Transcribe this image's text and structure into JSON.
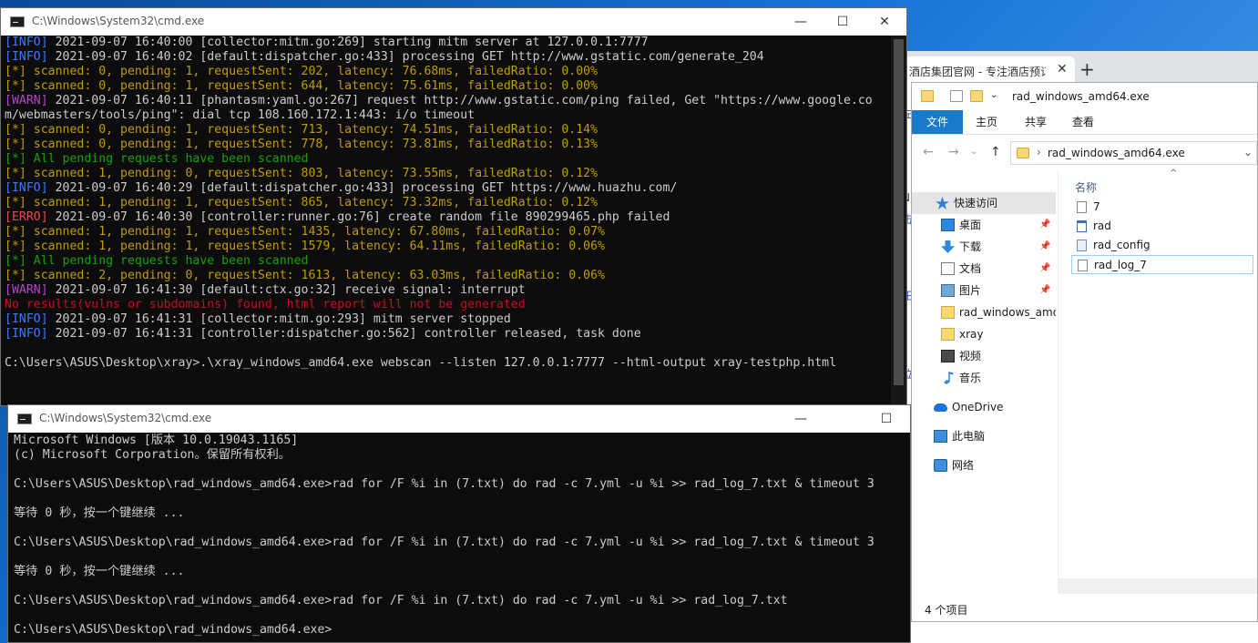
{
  "browser": {
    "tab_title": "酒店集团官网 - 专注酒店预订",
    "tab_close": "✕",
    "new_tab": "+",
    "side_marks": [
      "左",
      "N",
      "击",
      "正",
      "泣"
    ]
  },
  "cmd_top": {
    "title": "C:\\Windows\\System32\\cmd.exe",
    "controls": {
      "minimize": "—",
      "maximize": "☐",
      "close": "✕"
    },
    "lines": [
      {
        "segs": [
          {
            "t": "[INFO]",
            "c": "#3b78ff"
          },
          {
            "t": " 2021-09-07 16:40:00 [collector:mitm.go:269] starting mitm server at 127.0.0.1:7777",
            "c": "#cccccc"
          }
        ]
      },
      {
        "segs": [
          {
            "t": "[INFO]",
            "c": "#3b78ff"
          },
          {
            "t": " 2021-09-07 16:40:02 [default:dispatcher.go:433] processing GET http://www.gstatic.com/generate_204",
            "c": "#cccccc"
          }
        ]
      },
      {
        "segs": [
          {
            "t": "[*] scanned: 0, pending: 1, requestSent: 202, latency: 76.68ms, failedRatio: 0.00%",
            "c": "#c19c00"
          }
        ]
      },
      {
        "segs": [
          {
            "t": "[*] scanned: 0, pending: 1, requestSent: 644, latency: 75.61ms, failedRatio: 0.00%",
            "c": "#c19c00"
          }
        ]
      },
      {
        "segs": [
          {
            "t": "[WARN]",
            "c": "#b148c6"
          },
          {
            "t": " 2021-09-07 16:40:11 [phantasm:yaml.go:267] request http://www.gstatic.com/ping failed, Get \"https://www.google.co",
            "c": "#cccccc"
          }
        ]
      },
      {
        "segs": [
          {
            "t": "m/webmasters/tools/ping\": dial tcp 108.160.172.1:443: i/o timeout",
            "c": "#cccccc"
          }
        ]
      },
      {
        "segs": [
          {
            "t": "[*] scanned: 0, pending: 1, requestSent: 713, latency: 74.51ms, failedRatio: 0.14%",
            "c": "#c19c00"
          }
        ]
      },
      {
        "segs": [
          {
            "t": "[*] scanned: 0, pending: 1, requestSent: 778, latency: 73.81ms, failedRatio: 0.13%",
            "c": "#c19c00"
          }
        ]
      },
      {
        "segs": [
          {
            "t": "[*] All pending requests have been scanned",
            "c": "#13a10e"
          }
        ]
      },
      {
        "segs": [
          {
            "t": "[*] scanned: 1, pending: 0, requestSent: 803, latency: 73.55ms, failedRatio: 0.12%",
            "c": "#c19c00"
          }
        ]
      },
      {
        "segs": [
          {
            "t": "[INFO]",
            "c": "#3b78ff"
          },
          {
            "t": " 2021-09-07 16:40:29 [default:dispatcher.go:433] processing GET https://www.huazhu.com/",
            "c": "#cccccc"
          }
        ]
      },
      {
        "segs": [
          {
            "t": "[*] scanned: 1, pending: 1, requestSent: 865, latency: 73.32ms, failedRatio: 0.12%",
            "c": "#c19c00"
          }
        ]
      },
      {
        "segs": [
          {
            "t": "[ERRO]",
            "c": "#e74856"
          },
          {
            "t": " 2021-09-07 16:40:30 [controller:runner.go:76] create random file 890299465.php failed",
            "c": "#cccccc"
          }
        ]
      },
      {
        "segs": [
          {
            "t": "[*] scanned: 1, pending: 1, requestSent: 1435, latency: 67.80ms, failedRatio: 0.07%",
            "c": "#c19c00"
          }
        ]
      },
      {
        "segs": [
          {
            "t": "[*] scanned: 1, pending: 1, requestSent: 1579, latency: 64.11ms, failedRatio: 0.06%",
            "c": "#c19c00"
          }
        ]
      },
      {
        "segs": [
          {
            "t": "[*] All pending requests have been scanned",
            "c": "#13a10e"
          }
        ]
      },
      {
        "segs": [
          {
            "t": "[*] scanned: 2, pending: 0, requestSent: 1613, latency: 63.03ms, failedRatio: 0.06%",
            "c": "#c19c00"
          }
        ]
      },
      {
        "segs": [
          {
            "t": "[WARN]",
            "c": "#b148c6"
          },
          {
            "t": " 2021-09-07 16:41:30 [default:ctx.go:32] receive signal: interrupt",
            "c": "#cccccc"
          }
        ]
      },
      {
        "segs": [
          {
            "t": "No results(vulns or subdomains) found, html report will not be generated",
            "c": "#c50f1f"
          }
        ]
      },
      {
        "segs": [
          {
            "t": "[INFO]",
            "c": "#3b78ff"
          },
          {
            "t": " 2021-09-07 16:41:31 [collector:mitm.go:293] mitm server stopped",
            "c": "#cccccc"
          }
        ]
      },
      {
        "segs": [
          {
            "t": "[INFO]",
            "c": "#3b78ff"
          },
          {
            "t": " 2021-09-07 16:41:31 [controller:dispatcher.go:562] controller released, task done",
            "c": "#cccccc"
          }
        ]
      },
      {
        "segs": [
          {
            "t": "",
            "c": "#cccccc"
          }
        ]
      },
      {
        "segs": [
          {
            "t": "C:\\Users\\ASUS\\Desktop\\xray>.\\xray_windows_amd64.exe webscan --listen 127.0.0.1:7777 --html-output xray-testphp.html",
            "c": "#cccccc"
          }
        ]
      }
    ]
  },
  "cmd_bottom": {
    "title": "C:\\Windows\\System32\\cmd.exe",
    "controls": {
      "minimize": "—",
      "maximize": "☐"
    },
    "lines": [
      "Microsoft Windows [版本 10.0.19043.1165]",
      "(c) Microsoft Corporation。保留所有权利。",
      "",
      "C:\\Users\\ASUS\\Desktop\\rad_windows_amd64.exe>rad for /F %i in (7.txt) do rad -c 7.yml -u %i >> rad_log_7.txt & timeout 3",
      "",
      "等待 0 秒，按一个键继续 ...",
      "",
      "C:\\Users\\ASUS\\Desktop\\rad_windows_amd64.exe>rad for /F %i in (7.txt) do rad -c 7.yml -u %i >> rad_log_7.txt & timeout 3",
      "",
      "等待 0 秒，按一个键继续 ...",
      "",
      "C:\\Users\\ASUS\\Desktop\\rad_windows_amd64.exe>rad for /F %i in (7.txt) do rad -c 7.yml -u %i >> rad_log_7.txt",
      "",
      "C:\\Users\\ASUS\\Desktop\\rad_windows_amd64.exe>"
    ]
  },
  "explorer": {
    "title": "rad_windows_amd64.exe",
    "ribbon_tabs": [
      "文件",
      "主页",
      "共享",
      "查看"
    ],
    "nav_back": "←",
    "nav_forward": "→",
    "nav_dropdown": "⌄",
    "nav_up": "↑",
    "address_sep": "›",
    "address": "rad_windows_amd64.exe",
    "address_dropdown": "⌄",
    "nav_items": [
      {
        "label": "快速访问",
        "icon": "star-icon",
        "pinned": false
      },
      {
        "label": "桌面",
        "icon": "desktop-icon",
        "pinned": true
      },
      {
        "label": "下载",
        "icon": "download-icon",
        "pinned": true
      },
      {
        "label": "文档",
        "icon": "documents-icon",
        "pinned": true
      },
      {
        "label": "图片",
        "icon": "pictures-icon",
        "pinned": true
      },
      {
        "label": "rad_windows_amd",
        "icon": "folder-icon",
        "pinned": false
      },
      {
        "label": "xray",
        "icon": "folder-icon",
        "pinned": false
      },
      {
        "label": "视频",
        "icon": "video-icon",
        "pinned": false
      },
      {
        "label": "音乐",
        "icon": "music-icon",
        "pinned": false
      },
      {
        "label": "OneDrive",
        "icon": "cloud-icon",
        "pinned": false
      },
      {
        "label": "此电脑",
        "icon": "computer-icon",
        "pinned": false
      },
      {
        "label": "网络",
        "icon": "network-icon",
        "pinned": false
      }
    ],
    "pin_glyph": "📌",
    "column_name": "名称",
    "sort_glyph": "^",
    "files": [
      {
        "name": "7",
        "icon": "text-file-icon",
        "selected": false
      },
      {
        "name": "rad",
        "icon": "app-file-icon",
        "selected": false
      },
      {
        "name": "rad_config",
        "icon": "config-file-icon",
        "selected": false
      },
      {
        "name": "rad_log_7",
        "icon": "text-file-icon",
        "selected": true
      }
    ],
    "status": "4 个项目",
    "accent": "#1979ca"
  }
}
